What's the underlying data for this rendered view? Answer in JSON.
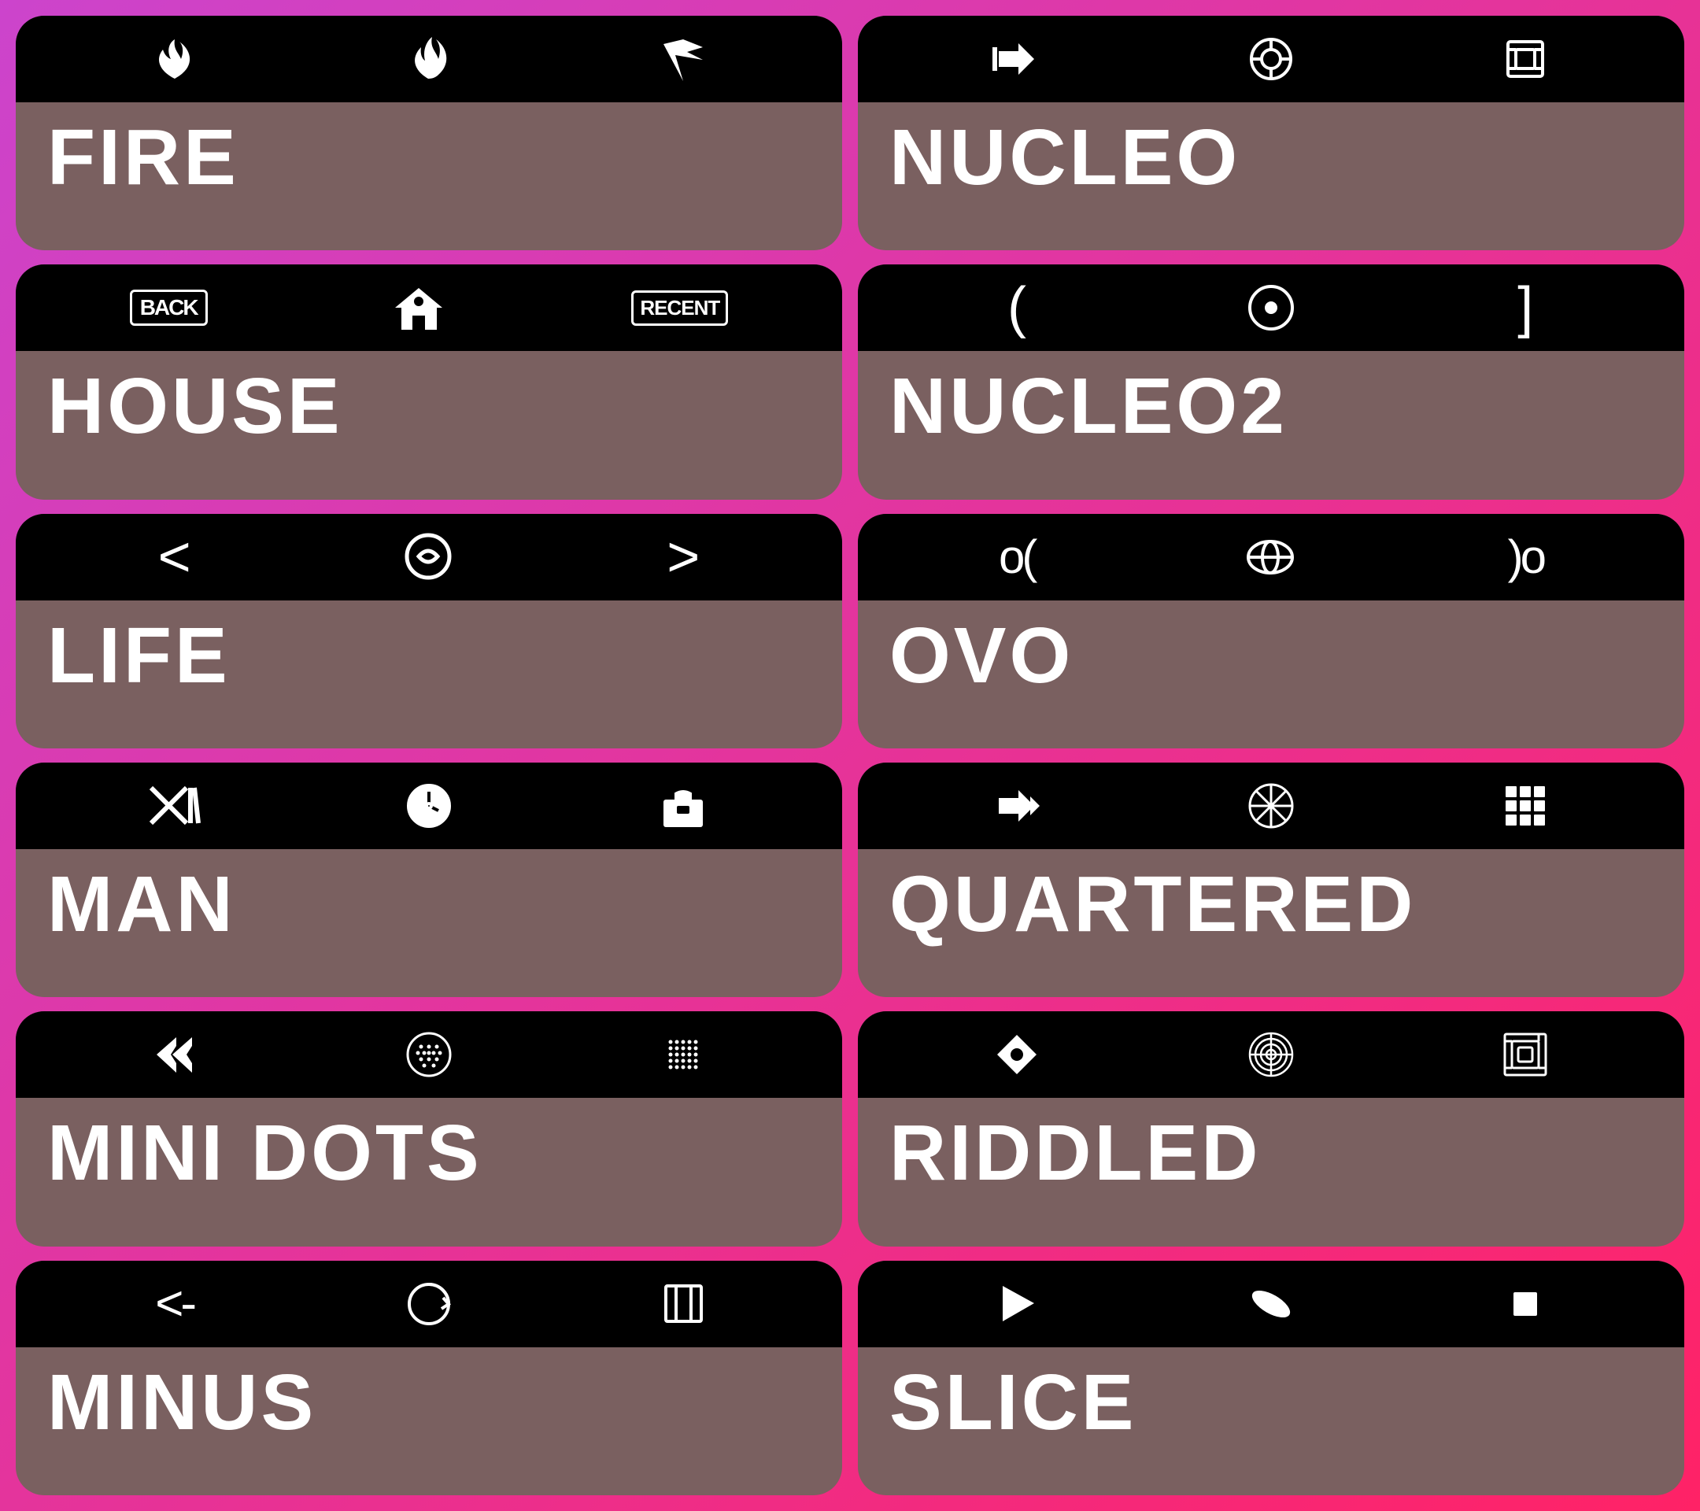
{
  "columns": [
    {
      "id": "left",
      "cards": [
        {
          "id": "fire",
          "label": "FIRE",
          "icons": [
            "🍃",
            "🔥",
            "🏳"
          ]
        },
        {
          "id": "house",
          "label": "HoUse",
          "icons": [
            "◀",
            "🏠",
            "▶"
          ]
        },
        {
          "id": "life",
          "label": "LIFE",
          "icons": [
            "<",
            "◯",
            ">"
          ]
        },
        {
          "id": "man",
          "label": "MAN",
          "icons": [
            "✂",
            "⏱",
            "💼"
          ]
        },
        {
          "id": "mini-dots",
          "label": "MINI DOTS",
          "icons": [
            "◀◀",
            "⠿",
            "⠶"
          ]
        },
        {
          "id": "minus",
          "label": "MINUS",
          "icons": [
            "<-",
            "⊙",
            "▭"
          ]
        }
      ]
    },
    {
      "id": "right",
      "cards": [
        {
          "id": "nucleo",
          "label": "NUCLEO",
          "icons": [
            "◁",
            "◎",
            "▣"
          ]
        },
        {
          "id": "nucleo2",
          "label": "NUCLEO2",
          "icons": [
            "(",
            "⊙",
            "]"
          ]
        },
        {
          "id": "ovo",
          "label": "OVO",
          "icons": [
            "o(",
            "⊗",
            ")o"
          ]
        },
        {
          "id": "quartered",
          "label": "QUARTERED",
          "icons": [
            "◀",
            "⊕",
            "⠿"
          ]
        },
        {
          "id": "riddled",
          "label": "RIDDLED",
          "icons": [
            "▷",
            "◎",
            "▣"
          ]
        },
        {
          "id": "slice",
          "label": "SLICE",
          "icons": [
            "◀",
            "⬟",
            "■"
          ]
        }
      ]
    }
  ],
  "icon_symbols": {
    "fire": [
      "🍂",
      "🔥",
      "⚑"
    ],
    "house_back": "BACK",
    "house_home": "🏠",
    "house_recent": "RECENT",
    "life_left": "<",
    "life_mid": "◯",
    "life_right": "≥",
    "man_tool": "✂✕",
    "man_clock": "⏱",
    "man_bag": "💼",
    "minidots_left": "◀◀",
    "minidots_mid": "⠿",
    "minidots_right": "⠶",
    "minus_left": "←",
    "minus_mid": "↺",
    "minus_right": "□"
  }
}
